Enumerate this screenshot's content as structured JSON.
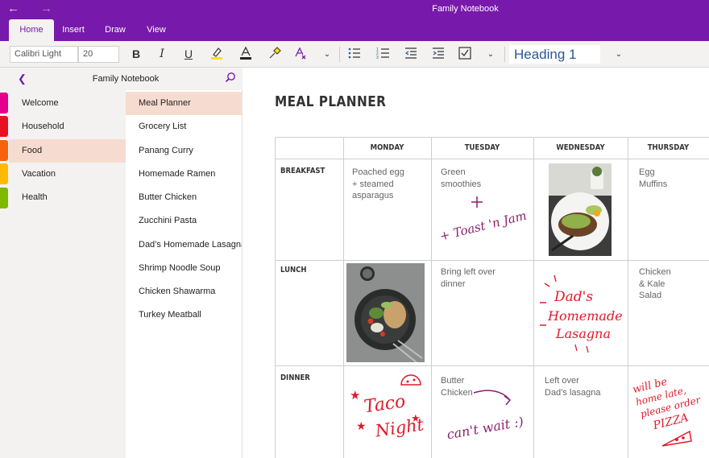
{
  "app": {
    "window_title": "Family Notebook",
    "accent_color": "#7719aa"
  },
  "ribbon": {
    "tabs": [
      {
        "label": "Home",
        "active": true
      },
      {
        "label": "Insert",
        "active": false
      },
      {
        "label": "Draw",
        "active": false
      },
      {
        "label": "View",
        "active": false
      }
    ]
  },
  "toolbar": {
    "font_name": "Calibri Light",
    "font_size": "20",
    "style": "Heading 1",
    "icons": [
      "bold-icon",
      "italic-icon",
      "underline-icon",
      "highlight-icon",
      "font-color-icon",
      "format-painter-icon",
      "clear-format-icon",
      "chevron-down-icon",
      "bullets-icon",
      "numbering-icon",
      "outdent-icon",
      "indent-icon",
      "checkbox-icon",
      "chevron-down-icon",
      "chevron-down-icon"
    ]
  },
  "notebook": {
    "title": "Family Notebook",
    "sections": [
      {
        "label": "Welcome",
        "color": "#e3008c"
      },
      {
        "label": "Household",
        "color": "#e81123"
      },
      {
        "label": "Food",
        "color": "#f7630c",
        "active": true
      },
      {
        "label": "Vacation",
        "color": "#ffb900"
      },
      {
        "label": "Health",
        "color": "#7fba00"
      }
    ],
    "pages": [
      {
        "label": "Meal Planner",
        "active": true
      },
      {
        "label": "Grocery List"
      },
      {
        "label": "Panang Curry"
      },
      {
        "label": "Homemade Ramen"
      },
      {
        "label": "Butter Chicken"
      },
      {
        "label": "Zucchini Pasta"
      },
      {
        "label": "Dad’s Homemade Lasagna"
      },
      {
        "label": "Shrimp Noodle Soup"
      },
      {
        "label": "Chicken Shawarma"
      },
      {
        "label": "Turkey Meatball"
      }
    ]
  },
  "page": {
    "title": "MEAL PLANNER",
    "columns": [
      "MONDAY",
      "TUESDAY",
      "WEDNESDAY",
      "THURSDAY"
    ],
    "rows": [
      "BREAKFAST",
      "LUNCH",
      "DINNER"
    ],
    "cells": {
      "breakfast_monday": "Poached egg\n+ steamed\nasparagus",
      "breakfast_tuesday": "Green\nsmoothies",
      "breakfast_thursday": "Egg\nMuffins",
      "lunch_tuesday": "Bring left over\ndinner",
      "lunch_thursday": "Chicken\n& Kale\nSalad",
      "dinner_tuesday": "Butter\nChicken",
      "dinner_wednesday": "Left over\nDad’s lasagna"
    },
    "ink": {
      "toast": "+ Toast 'n Jam please!",
      "lasagna": "Dad's Homemade Lasagna",
      "taco": "Taco Night",
      "cant_wait": "can't wait :)",
      "pizza": "will be home late, please order PIZZA"
    }
  }
}
